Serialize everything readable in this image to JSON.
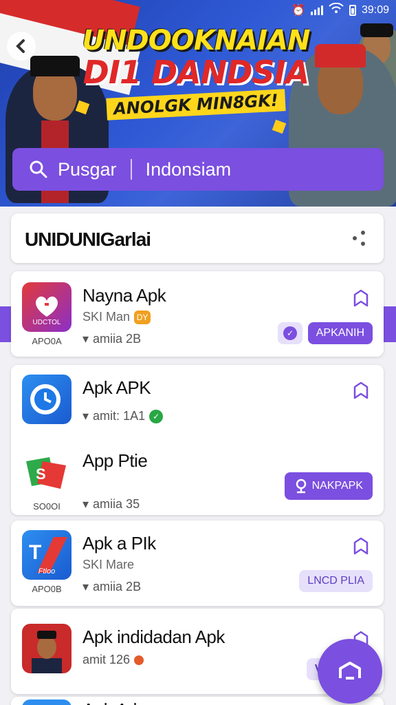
{
  "status_bar": {
    "time": "39:09"
  },
  "banner": {
    "headline_line1": "UNDOOKNAIAN",
    "headline_line2": "DI1 DANDSIA",
    "headline_line3": "ANOLGK MIN8GK!"
  },
  "search": {
    "label": "Pusgar",
    "value": "Indonsiam"
  },
  "list_header": {
    "title": "UNIDUNIGarlai"
  },
  "apps": [
    {
      "name": "Nayna Apk",
      "sub": "SKI Man",
      "sub_badge": "DY",
      "meta": "amiia 2B",
      "code": "APO0A",
      "action": "APKANIH",
      "icon_text": "UDCTOL"
    },
    {
      "name": "Apk APK",
      "meta": "amit: 1A1"
    },
    {
      "name": "App Ptie",
      "meta": "amiia 35",
      "code": "SO0OI",
      "action": "NAKPAPK"
    },
    {
      "name": "Apk a PIk",
      "sub": "SKI Mare",
      "meta": "amiia 2B",
      "code": "APO0B",
      "action": "LNCD PLIA",
      "icon_text": "Ftloo"
    },
    {
      "name": "Apk indidadan Apk",
      "meta": "amit 126",
      "action": "R"
    },
    {
      "name": "Apk Arlp"
    }
  ],
  "colors": {
    "accent": "#7b4fe0",
    "accent_soft": "#e7e0fb",
    "banner": "#2f5ad6"
  }
}
